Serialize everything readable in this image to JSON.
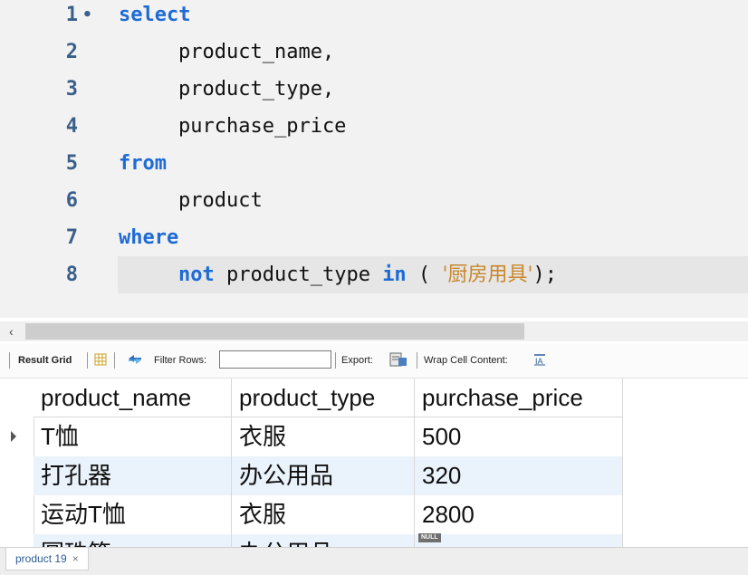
{
  "editor": {
    "lines": [
      {
        "num": "1",
        "dot": "•",
        "kw": "select"
      },
      {
        "num": "2",
        "text": "product_name,"
      },
      {
        "num": "3",
        "text": "product_type,"
      },
      {
        "num": "4",
        "text": "purchase_price"
      },
      {
        "num": "5",
        "kw": "from"
      },
      {
        "num": "6",
        "text": "product"
      },
      {
        "num": "7",
        "kw": "where"
      },
      {
        "num": "8",
        "kw_not": "not",
        "text_mid": " product_type ",
        "kw_in": "in",
        "paren_open": " ( ",
        "str": "'厨房用具'",
        "paren_close": ");"
      }
    ],
    "colors": {
      "keyword": "#1e6bd6",
      "string": "#c8872a",
      "line_number": "#3a5f8a",
      "background": "#f2f2f2",
      "current_line": "#e6e6e6"
    }
  },
  "scrollbar": {
    "left_arrow": "‹"
  },
  "toolbar": {
    "result_grid_label": "Result Grid",
    "grid_icon": "grid-view-icon",
    "refresh_icon": "refresh-arrows-icon",
    "filter_rows_label": "Filter Rows:",
    "filter_value": "",
    "export_label": "Export:",
    "export_icon": "export-file-icon",
    "wrap_label": "Wrap Cell Content:",
    "wrap_icon": "wrap-text-icon"
  },
  "grid": {
    "columns": [
      "product_name",
      "product_type",
      "purchase_price"
    ],
    "rows": [
      [
        "T恤",
        "衣服",
        "500"
      ],
      [
        "打孔器",
        "办公用品",
        "320"
      ],
      [
        "运动T恤",
        "衣服",
        "2800"
      ],
      [
        "圆珠笔",
        "办公用品",
        "NULL"
      ]
    ],
    "zebra_color": "#eaf2fb"
  },
  "tab": {
    "label": "product 19",
    "close": "×"
  }
}
